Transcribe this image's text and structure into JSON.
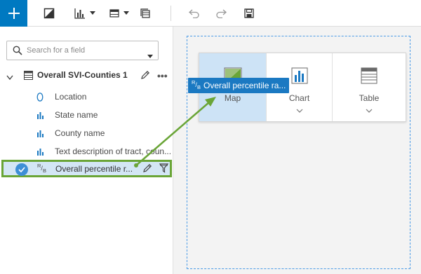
{
  "toolbar": {
    "add_icon": "plus-icon",
    "colors": {
      "accent": "#0079c1"
    }
  },
  "data_pane": {
    "search": {
      "placeholder": "Search for a field"
    },
    "dataset": {
      "name": "Overall SVI-Counties 1"
    },
    "fields": [
      {
        "label": "Location",
        "icon": "location-icon"
      },
      {
        "label": "State name",
        "icon": "string-field-icon"
      },
      {
        "label": "County name",
        "icon": "string-field-icon"
      },
      {
        "label": "Text description of tract, coun...",
        "icon": "string-field-icon"
      }
    ],
    "selected_field": {
      "type_glyph": "R/B",
      "label": "Overall percentile r..."
    }
  },
  "canvas": {
    "viz_options": [
      {
        "label": "Map"
      },
      {
        "label": "Chart"
      },
      {
        "label": "Table"
      }
    ],
    "drag_chip": {
      "type_glyph": "R/B",
      "label": "Overall percentile ra..."
    }
  },
  "colors": {
    "selection_border": "#6aa537",
    "selection_fill": "#d3e6f5",
    "drop_zone": "#4b9be6",
    "drag_chip": "#1b79c2"
  }
}
